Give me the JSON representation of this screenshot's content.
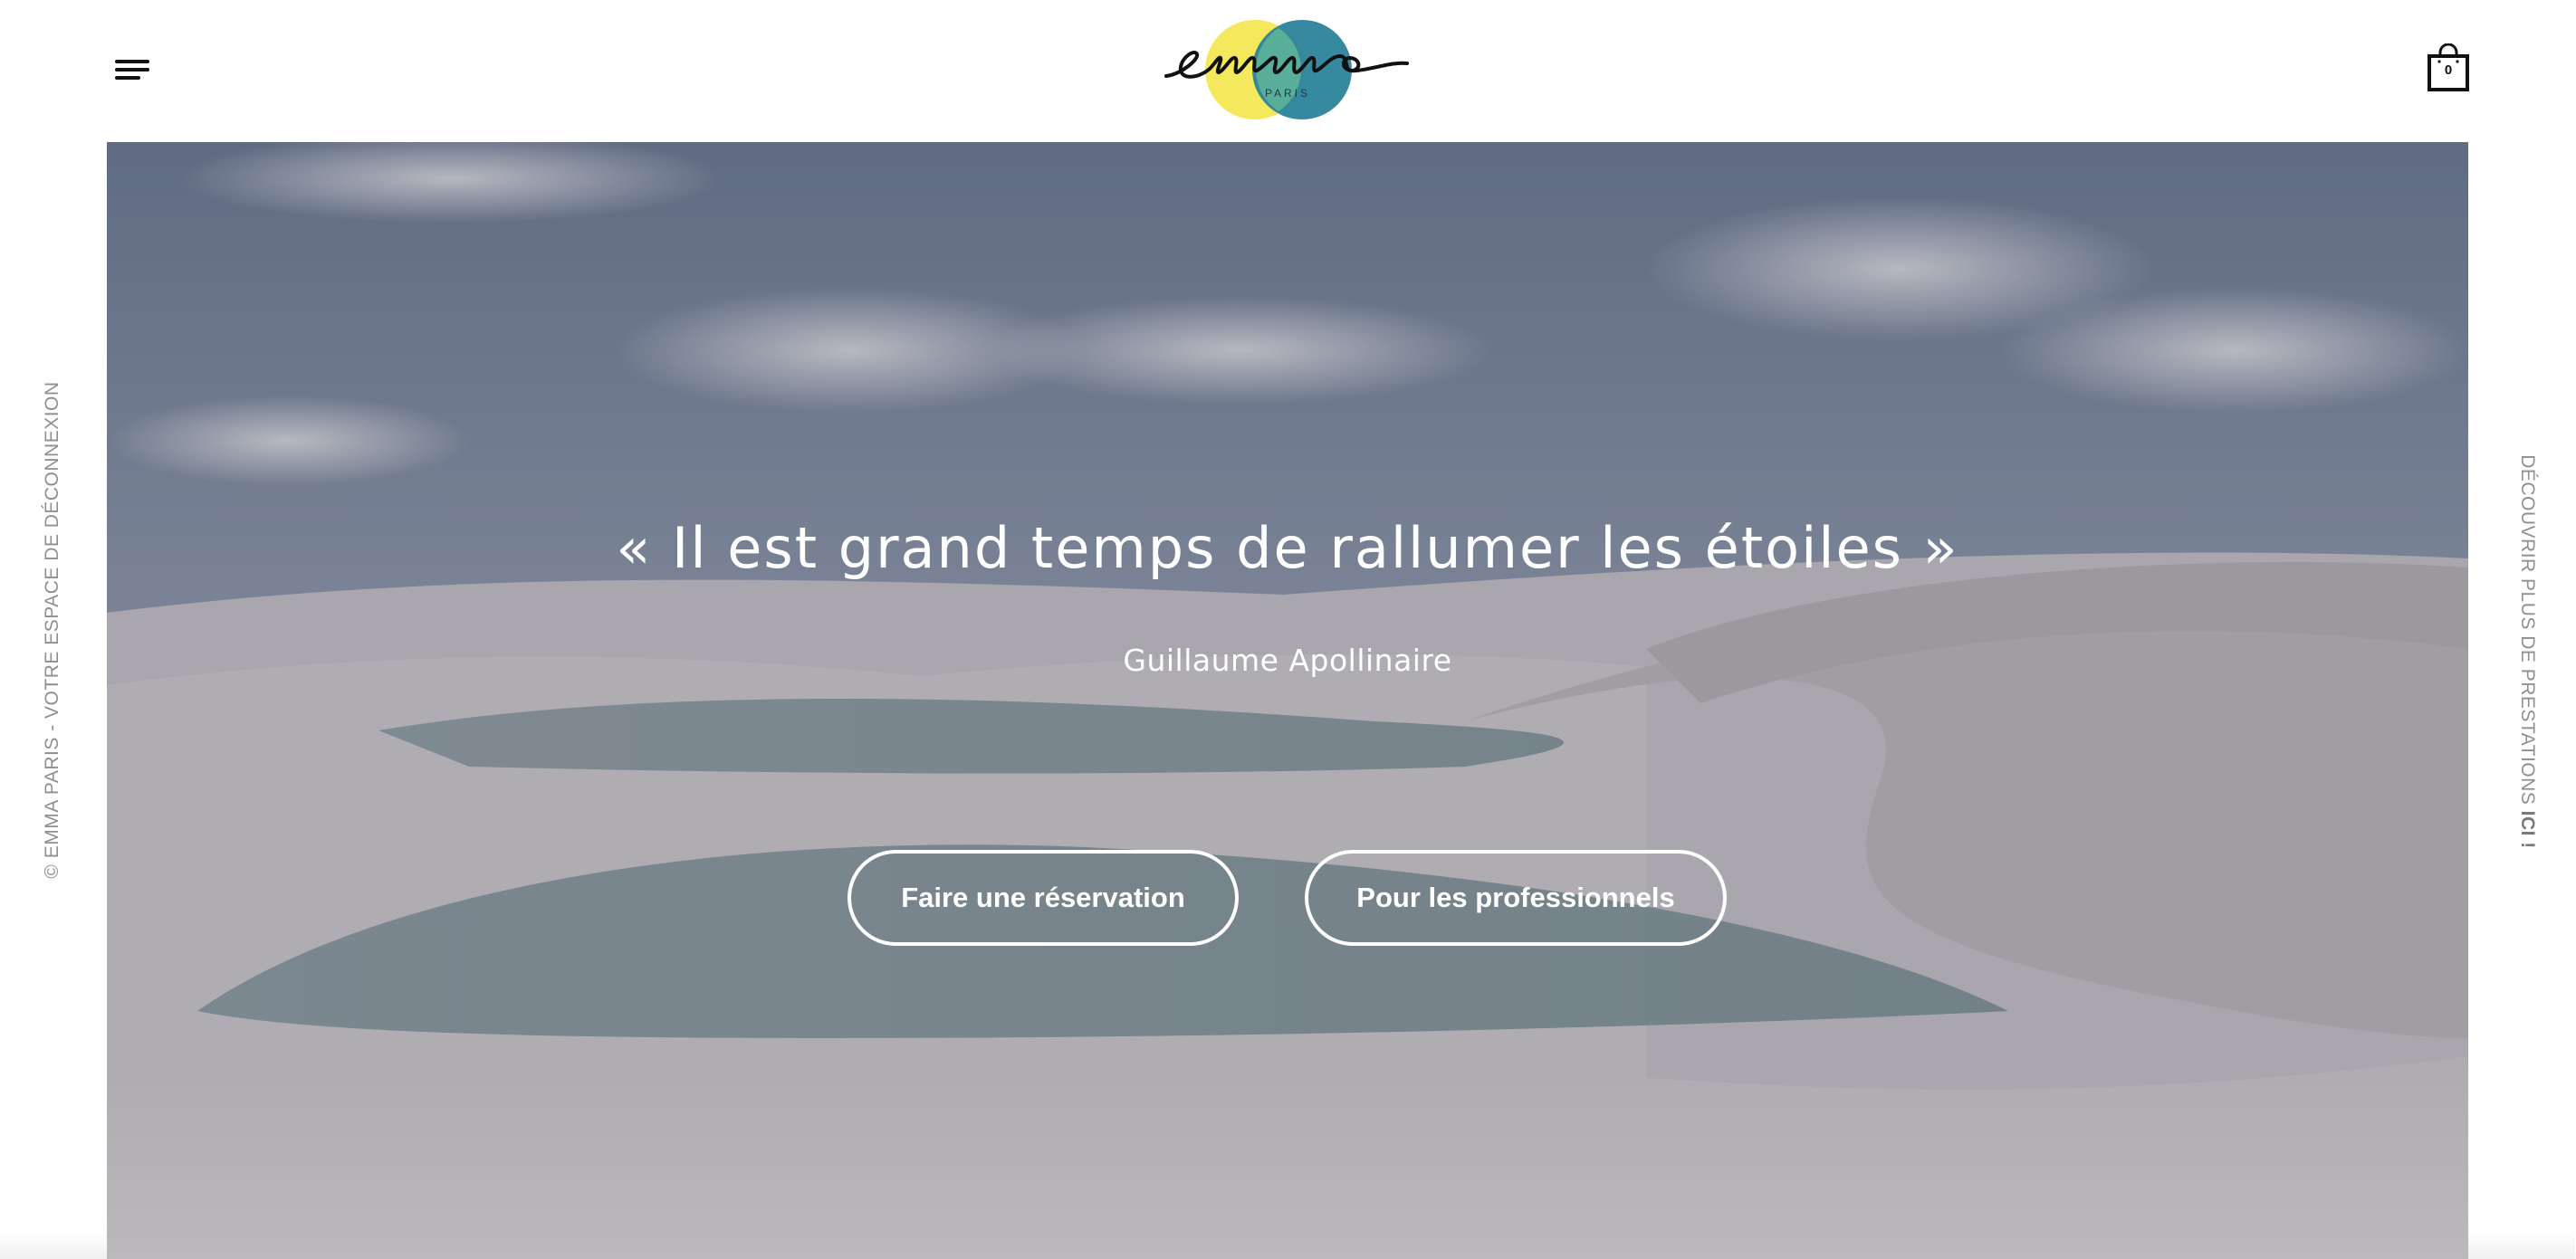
{
  "header": {
    "menu_icon": "hamburger-menu-icon",
    "logo": {
      "wordmark": "emma",
      "subtitle": "PARIS",
      "colors": {
        "yellow": "#f4e85c",
        "teal": "#2b8399",
        "ink": "#111111"
      }
    },
    "cart": {
      "icon": "shopping-bag-icon",
      "count": "0"
    }
  },
  "side": {
    "left_text": "© EMMA PARIS - VOTRE ESPACE DE DÉCONNEXION",
    "right_text": "DÉCOUVRIR PLUS DE PRESTATIONS ",
    "right_text_strong": "ICI !"
  },
  "hero": {
    "quote": "« Il est grand temps de rallumer les étoiles »",
    "author": "Guillaume Apollinaire",
    "buttons": {
      "reserve": "Faire une réservation",
      "pro": "Pour les professionnels"
    },
    "background": "white sand dunes with lagoons under a cloudy sky"
  }
}
